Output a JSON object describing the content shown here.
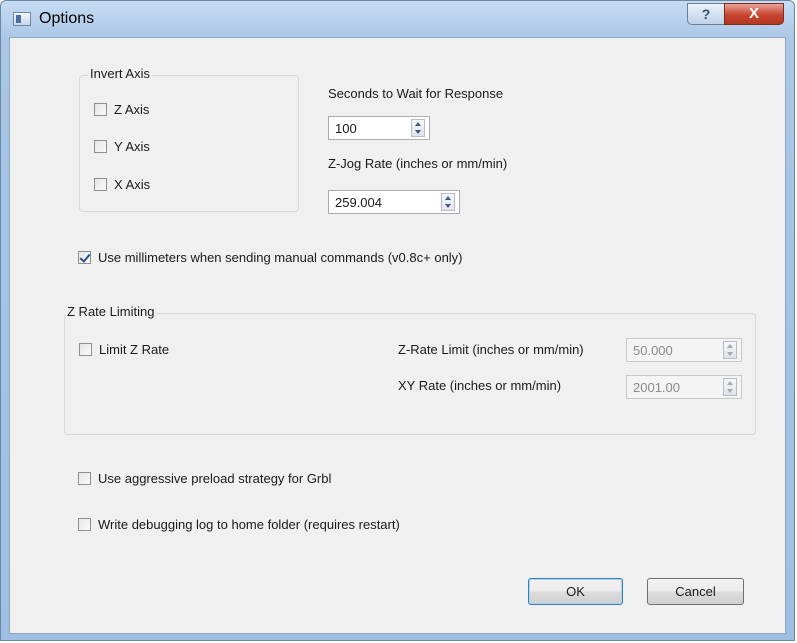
{
  "window": {
    "title": "Options",
    "help_label": "?",
    "close_label": "X"
  },
  "invert_axis": {
    "title": "Invert Axis",
    "items": [
      {
        "label": "Z Axis",
        "checked": false
      },
      {
        "label": "Y Axis",
        "checked": false
      },
      {
        "label": "X Axis",
        "checked": false
      }
    ]
  },
  "response": {
    "label": "Seconds to Wait for Response",
    "value": "100"
  },
  "zjog": {
    "label": "Z-Jog Rate (inches or mm/min)",
    "value": "259.004"
  },
  "use_mm": {
    "label": "Use millimeters when sending manual commands (v0.8c+ only)",
    "checked": true
  },
  "z_rate": {
    "title": "Z Rate Limiting",
    "limit_label": "Limit Z Rate",
    "limit_checked": false,
    "zrate_label": "Z-Rate Limit (inches or mm/min)",
    "zrate_value": "50.000",
    "xy_label": "XY Rate (inches or mm/min)",
    "xy_value": "2001.00"
  },
  "preload": {
    "label": "Use aggressive preload strategy for Grbl",
    "checked": false
  },
  "debug": {
    "label": "Write debugging log to home folder (requires restart)",
    "checked": false
  },
  "buttons": {
    "ok": "OK",
    "cancel": "Cancel"
  }
}
